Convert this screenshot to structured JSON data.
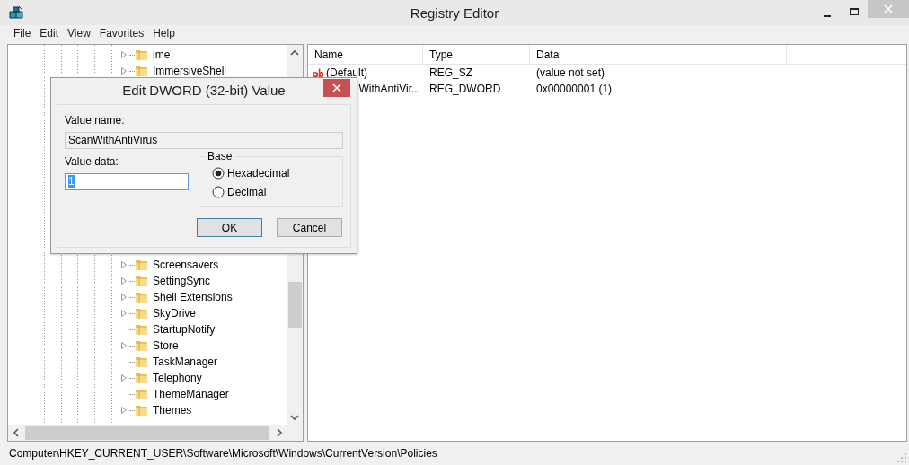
{
  "window": {
    "title": "Registry Editor"
  },
  "menu": [
    "File",
    "Edit",
    "View",
    "Favorites",
    "Help"
  ],
  "tree": {
    "items": [
      {
        "label": "ime",
        "expandable": true
      },
      {
        "label": "ImmersiveShell",
        "expandable": true
      },
      {
        "label": "Screensavers",
        "expandable": true
      },
      {
        "label": "SettingSync",
        "expandable": true
      },
      {
        "label": "Shell Extensions",
        "expandable": true
      },
      {
        "label": "SkyDrive",
        "expandable": true
      },
      {
        "label": "StartupNotify",
        "expandable": false
      },
      {
        "label": "Store",
        "expandable": true
      },
      {
        "label": "TaskManager",
        "expandable": false
      },
      {
        "label": "Telephony",
        "expandable": true
      },
      {
        "label": "ThemeManager",
        "expandable": false
      },
      {
        "label": "Themes",
        "expandable": true
      }
    ]
  },
  "values": {
    "columns": [
      "Name",
      "Type",
      "Data"
    ],
    "rows": [
      {
        "name": "(Default)",
        "type": "REG_SZ",
        "data": "(value not set)",
        "kind": "string"
      },
      {
        "name": "WithAntiVir...",
        "type": "REG_DWORD",
        "data": "0x00000001 (1)"
      }
    ]
  },
  "dialog": {
    "title": "Edit DWORD (32-bit) Value",
    "value_name_label": "Value name:",
    "value_name": "ScanWithAntiVirus",
    "value_data_label": "Value data:",
    "value_data": "1",
    "value_data_selected": true,
    "base_label": "Base",
    "base_options": [
      {
        "label": "Hexadecimal",
        "selected": true
      },
      {
        "label": "Decimal",
        "selected": false
      }
    ],
    "buttons": [
      {
        "label": "OK",
        "default": true
      },
      {
        "label": "Cancel",
        "default": false
      }
    ]
  },
  "status_bar": "Computer\\HKEY_CURRENT_USER\\Software\\Microsoft\\Windows\\CurrentVersion\\Policies"
}
